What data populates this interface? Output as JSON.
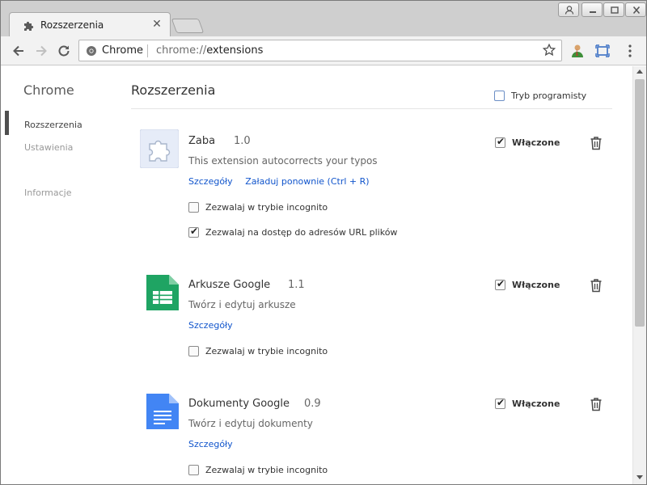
{
  "tab": {
    "title": "Rozszerzenia",
    "icon": "puzzle-icon"
  },
  "window_controls": [
    "user-icon",
    "minimize-icon",
    "maximize-icon",
    "close-icon"
  ],
  "omnibox": {
    "site": "Chrome",
    "url_scheme": "chrome://",
    "url_path": "extensions"
  },
  "sidebar": {
    "title": "Chrome",
    "items": [
      {
        "label": "Rozszerzenia",
        "active": true
      },
      {
        "label": "Ustawienia",
        "active": false
      },
      {
        "label": "Informacje",
        "active": false
      }
    ]
  },
  "main": {
    "title": "Rozszerzenia",
    "developer_mode": {
      "label": "Tryb programisty",
      "checked": false
    }
  },
  "extensions": [
    {
      "name": "Zaba",
      "version": "1.0",
      "description": "This extension autocorrects your typos",
      "icon": "puzzle-icon",
      "links": [
        "Szczegóły",
        "Załaduj ponownie (Ctrl + R)"
      ],
      "options": [
        {
          "label": "Zezwalaj w trybie incognito",
          "checked": false
        },
        {
          "label": "Zezwalaj na dostęp do adresów URL plików",
          "checked": true
        }
      ],
      "enabled_label": "Włączone",
      "enabled": true
    },
    {
      "name": "Arkusze Google",
      "version": "1.1",
      "description": "Twórz i edytuj arkusze",
      "icon": "sheets-icon",
      "links": [
        "Szczegóły"
      ],
      "options": [
        {
          "label": "Zezwalaj w trybie incognito",
          "checked": false
        }
      ],
      "enabled_label": "Włączone",
      "enabled": true
    },
    {
      "name": "Dokumenty Google",
      "version": "0.9",
      "description": "Twórz i edytuj dokumenty",
      "icon": "docs-icon",
      "links": [
        "Szczegóły"
      ],
      "options": [
        {
          "label": "Zezwalaj w trybie incognito",
          "checked": false
        }
      ],
      "enabled_label": "Włączone",
      "enabled": true
    }
  ],
  "colors": {
    "link": "#1155cc",
    "sheets": "#1fa463",
    "docs": "#4285f4"
  }
}
